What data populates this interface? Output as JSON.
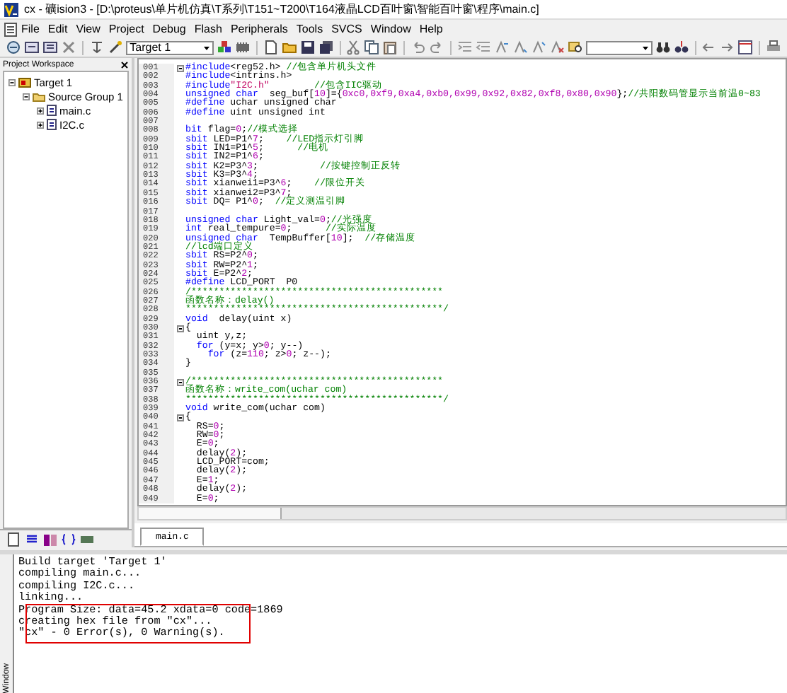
{
  "window": {
    "title": "cx - 礦ision3 - [D:\\proteus\\单片机仿真\\T系列\\T151~T200\\T164液晶LCD百叶窗\\智能百叶窗\\程序\\main.c]"
  },
  "menu": [
    "File",
    "Edit",
    "View",
    "Project",
    "Debug",
    "Flash",
    "Peripherals",
    "Tools",
    "SVCS",
    "Window",
    "Help"
  ],
  "toolbar": {
    "target": "Target 1"
  },
  "workspace": {
    "title": "Project Workspace",
    "tree": [
      {
        "label": "Target 1",
        "kind": "target",
        "expanded": true,
        "children": [
          {
            "label": "Source Group 1",
            "kind": "group",
            "expanded": true,
            "children": [
              {
                "label": "main.c",
                "kind": "file",
                "expanded": false
              },
              {
                "label": "I2C.c",
                "kind": "file",
                "expanded": false
              }
            ]
          }
        ]
      }
    ]
  },
  "editor": {
    "tabs": [
      {
        "label": "main.c",
        "selected": true
      }
    ],
    "lines": [
      {
        "number": "001",
        "fold": true,
        "parts": [
          {
            "kind": "keyword",
            "text": "#include"
          },
          {
            "kind": "plain",
            "text": "<reg52.h> "
          },
          {
            "kind": "comment",
            "text": "//包含单片机头文件"
          }
        ]
      },
      {
        "number": "002",
        "fold": false,
        "parts": [
          {
            "kind": "keyword",
            "text": "#include"
          },
          {
            "kind": "plain",
            "text": "<intrins.h>"
          }
        ]
      },
      {
        "number": "003",
        "fold": false,
        "parts": [
          {
            "kind": "keyword",
            "text": "#include"
          },
          {
            "kind": "string",
            "text": "\"I2C.h\""
          },
          {
            "kind": "comment",
            "text": "        //包含IIC驱动"
          }
        ]
      },
      {
        "number": "004",
        "fold": false,
        "parts": [
          {
            "kind": "keyword",
            "text": "unsigned char"
          },
          {
            "kind": "plain",
            "text": "  seg_buf["
          },
          {
            "kind": "number",
            "text": "10"
          },
          {
            "kind": "plain",
            "text": "]={"
          },
          {
            "kind": "number",
            "text": "0xc0,0xf9,0xa4,0xb0,0x99,0x92,0x82,0xf8,0x80,0x90"
          },
          {
            "kind": "plain",
            "text": "};"
          },
          {
            "kind": "comment",
            "text": "//共阳数码管显示当前温0~83"
          }
        ]
      },
      {
        "number": "005",
        "fold": false,
        "parts": [
          {
            "kind": "keyword",
            "text": "#define"
          },
          {
            "kind": "plain",
            "text": " uchar unsigned char"
          }
        ]
      },
      {
        "number": "006",
        "fold": false,
        "parts": [
          {
            "kind": "keyword",
            "text": "#define"
          },
          {
            "kind": "plain",
            "text": " uint unsigned int"
          }
        ]
      },
      {
        "number": "007",
        "fold": false
      },
      {
        "number": "008",
        "fold": false,
        "parts": [
          {
            "kind": "keyword",
            "text": "bit"
          },
          {
            "kind": "plain",
            "text": " flag="
          },
          {
            "kind": "number",
            "text": "0"
          },
          {
            "kind": "plain",
            "text": ";"
          },
          {
            "kind": "comment",
            "text": "//模式选择"
          }
        ]
      },
      {
        "number": "009",
        "fold": false,
        "parts": [
          {
            "kind": "keyword",
            "text": "sbit"
          },
          {
            "kind": "plain",
            "text": " LED=P1^"
          },
          {
            "kind": "number",
            "text": "7"
          },
          {
            "kind": "plain",
            "text": ";    "
          },
          {
            "kind": "comment",
            "text": "//LED指示灯引脚"
          }
        ]
      },
      {
        "number": "010",
        "fold": false,
        "parts": [
          {
            "kind": "keyword",
            "text": "sbit"
          },
          {
            "kind": "plain",
            "text": " IN1=P1^"
          },
          {
            "kind": "number",
            "text": "5"
          },
          {
            "kind": "plain",
            "text": ";      "
          },
          {
            "kind": "comment",
            "text": "//电机"
          }
        ]
      },
      {
        "number": "011",
        "fold": false,
        "parts": [
          {
            "kind": "keyword",
            "text": "sbit"
          },
          {
            "kind": "plain",
            "text": " IN2=P1^"
          },
          {
            "kind": "number",
            "text": "6"
          },
          {
            "kind": "plain",
            "text": ";"
          }
        ]
      },
      {
        "number": "012",
        "fold": false,
        "parts": [
          {
            "kind": "keyword",
            "text": "sbit"
          },
          {
            "kind": "plain",
            "text": " K2=P3^"
          },
          {
            "kind": "number",
            "text": "3"
          },
          {
            "kind": "plain",
            "text": ";           "
          },
          {
            "kind": "comment",
            "text": "//按键控制正反转"
          }
        ]
      },
      {
        "number": "013",
        "fold": false,
        "parts": [
          {
            "kind": "keyword",
            "text": "sbit"
          },
          {
            "kind": "plain",
            "text": " K3=P3^"
          },
          {
            "kind": "number",
            "text": "4"
          },
          {
            "kind": "plain",
            "text": ";"
          }
        ]
      },
      {
        "number": "014",
        "fold": false,
        "parts": [
          {
            "kind": "keyword",
            "text": "sbit"
          },
          {
            "kind": "plain",
            "text": " xianwei1=P3^"
          },
          {
            "kind": "number",
            "text": "6"
          },
          {
            "kind": "plain",
            "text": ";    "
          },
          {
            "kind": "comment",
            "text": "//限位开关"
          }
        ]
      },
      {
        "number": "015",
        "fold": false,
        "parts": [
          {
            "kind": "keyword",
            "text": "sbit"
          },
          {
            "kind": "plain",
            "text": " xianwei2=P3^"
          },
          {
            "kind": "number",
            "text": "7"
          },
          {
            "kind": "plain",
            "text": ";"
          }
        ]
      },
      {
        "number": "016",
        "fold": false,
        "parts": [
          {
            "kind": "keyword",
            "text": "sbit"
          },
          {
            "kind": "plain",
            "text": " DQ= P1^"
          },
          {
            "kind": "number",
            "text": "0"
          },
          {
            "kind": "plain",
            "text": ";  "
          },
          {
            "kind": "comment",
            "text": "//定义测温引脚"
          }
        ]
      },
      {
        "number": "017",
        "fold": false
      },
      {
        "number": "018",
        "fold": false,
        "parts": [
          {
            "kind": "keyword",
            "text": "unsigned char"
          },
          {
            "kind": "plain",
            "text": " Light_val="
          },
          {
            "kind": "number",
            "text": "0"
          },
          {
            "kind": "plain",
            "text": ";"
          },
          {
            "kind": "comment",
            "text": "//光强度"
          }
        ]
      },
      {
        "number": "019",
        "fold": false,
        "parts": [
          {
            "kind": "keyword",
            "text": "int"
          },
          {
            "kind": "plain",
            "text": " real_tempure="
          },
          {
            "kind": "number",
            "text": "0"
          },
          {
            "kind": "plain",
            "text": ";      "
          },
          {
            "kind": "comment",
            "text": "//实际温度"
          }
        ]
      },
      {
        "number": "020",
        "fold": false,
        "parts": [
          {
            "kind": "keyword",
            "text": "unsigned char"
          },
          {
            "kind": "plain",
            "text": "  TempBuffer["
          },
          {
            "kind": "number",
            "text": "10"
          },
          {
            "kind": "plain",
            "text": "];  "
          },
          {
            "kind": "comment",
            "text": "//存储温度"
          }
        ]
      },
      {
        "number": "021",
        "fold": false,
        "parts": [
          {
            "kind": "comment",
            "text": "//lcd端口定义"
          }
        ]
      },
      {
        "number": "022",
        "fold": false,
        "parts": [
          {
            "kind": "keyword",
            "text": "sbit"
          },
          {
            "kind": "plain",
            "text": " RS=P2^"
          },
          {
            "kind": "number",
            "text": "0"
          },
          {
            "kind": "plain",
            "text": ";"
          }
        ]
      },
      {
        "number": "023",
        "fold": false,
        "parts": [
          {
            "kind": "keyword",
            "text": "sbit"
          },
          {
            "kind": "plain",
            "text": " RW=P2^"
          },
          {
            "kind": "number",
            "text": "1"
          },
          {
            "kind": "plain",
            "text": ";"
          }
        ]
      },
      {
        "number": "024",
        "fold": false,
        "parts": [
          {
            "kind": "keyword",
            "text": "sbit"
          },
          {
            "kind": "plain",
            "text": " E=P2^"
          },
          {
            "kind": "number",
            "text": "2"
          },
          {
            "kind": "plain",
            "text": ";"
          }
        ]
      },
      {
        "number": "025",
        "fold": false,
        "parts": [
          {
            "kind": "keyword",
            "text": "#define"
          },
          {
            "kind": "plain",
            "text": " LCD_PORT  P0"
          }
        ]
      },
      {
        "number": "026",
        "fold": false,
        "parts": [
          {
            "kind": "comment",
            "text": "/*********************************************"
          }
        ]
      },
      {
        "number": "027",
        "fold": false,
        "parts": [
          {
            "kind": "comment",
            "text": "函数名称：delay()"
          }
        ]
      },
      {
        "number": "028",
        "fold": false,
        "parts": [
          {
            "kind": "comment",
            "text": "**********************************************/"
          }
        ]
      },
      {
        "number": "029",
        "fold": false,
        "parts": [
          {
            "kind": "keyword",
            "text": "void"
          },
          {
            "kind": "plain",
            "text": "  delay(uint x)"
          }
        ]
      },
      {
        "number": "030",
        "fold": true,
        "parts": [
          {
            "kind": "plain",
            "text": "{"
          }
        ]
      },
      {
        "number": "031",
        "fold": false,
        "parts": [
          {
            "kind": "plain",
            "text": "  uint y,z;"
          }
        ]
      },
      {
        "number": "032",
        "fold": false,
        "parts": [
          {
            "kind": "keyword",
            "text": "  for"
          },
          {
            "kind": "plain",
            "text": " (y=x; y>"
          },
          {
            "kind": "number",
            "text": "0"
          },
          {
            "kind": "plain",
            "text": "; y--)"
          }
        ]
      },
      {
        "number": "033",
        "fold": false,
        "parts": [
          {
            "kind": "keyword",
            "text": "    for"
          },
          {
            "kind": "plain",
            "text": " (z="
          },
          {
            "kind": "number",
            "text": "110"
          },
          {
            "kind": "plain",
            "text": "; z>"
          },
          {
            "kind": "number",
            "text": "0"
          },
          {
            "kind": "plain",
            "text": "; z--);"
          }
        ]
      },
      {
        "number": "034",
        "fold": false,
        "parts": [
          {
            "kind": "plain",
            "text": "}"
          }
        ]
      },
      {
        "number": "035",
        "fold": false
      },
      {
        "number": "036",
        "fold": true,
        "parts": [
          {
            "kind": "comment",
            "text": "/*********************************************"
          }
        ]
      },
      {
        "number": "037",
        "fold": false,
        "parts": [
          {
            "kind": "comment",
            "text": "函数名称：write_com(uchar com)"
          }
        ]
      },
      {
        "number": "038",
        "fold": false,
        "parts": [
          {
            "kind": "comment",
            "text": "**********************************************/"
          }
        ]
      },
      {
        "number": "039",
        "fold": false,
        "parts": [
          {
            "kind": "keyword",
            "text": "void"
          },
          {
            "kind": "plain",
            "text": " write_com(uchar com)"
          }
        ]
      },
      {
        "number": "040",
        "fold": true,
        "parts": [
          {
            "kind": "plain",
            "text": "{"
          }
        ]
      },
      {
        "number": "041",
        "fold": false,
        "parts": [
          {
            "kind": "plain",
            "text": "  RS="
          },
          {
            "kind": "number",
            "text": "0"
          },
          {
            "kind": "plain",
            "text": ";"
          }
        ]
      },
      {
        "number": "042",
        "fold": false,
        "parts": [
          {
            "kind": "plain",
            "text": "  RW="
          },
          {
            "kind": "number",
            "text": "0"
          },
          {
            "kind": "plain",
            "text": ";"
          }
        ]
      },
      {
        "number": "043",
        "fold": false,
        "parts": [
          {
            "kind": "plain",
            "text": "  E="
          },
          {
            "kind": "number",
            "text": "0"
          },
          {
            "kind": "plain",
            "text": ";"
          }
        ]
      },
      {
        "number": "044",
        "fold": false,
        "parts": [
          {
            "kind": "plain",
            "text": "  delay("
          },
          {
            "kind": "number",
            "text": "2"
          },
          {
            "kind": "plain",
            "text": ");"
          }
        ]
      },
      {
        "number": "045",
        "fold": false,
        "parts": [
          {
            "kind": "plain",
            "text": "  LCD_PORT=com;"
          }
        ]
      },
      {
        "number": "046",
        "fold": false,
        "parts": [
          {
            "kind": "plain",
            "text": "  delay("
          },
          {
            "kind": "number",
            "text": "2"
          },
          {
            "kind": "plain",
            "text": ");"
          }
        ]
      },
      {
        "number": "047",
        "fold": false,
        "parts": [
          {
            "kind": "plain",
            "text": "  E="
          },
          {
            "kind": "number",
            "text": "1"
          },
          {
            "kind": "plain",
            "text": ";"
          }
        ]
      },
      {
        "number": "048",
        "fold": false,
        "parts": [
          {
            "kind": "plain",
            "text": "  delay("
          },
          {
            "kind": "number",
            "text": "2"
          },
          {
            "kind": "plain",
            "text": ");"
          }
        ]
      },
      {
        "number": "049",
        "fold": false,
        "parts": [
          {
            "kind": "plain",
            "text": "  E="
          },
          {
            "kind": "number",
            "text": "0"
          },
          {
            "kind": "plain",
            "text": ";"
          }
        ]
      }
    ]
  },
  "output": {
    "title": "Window",
    "lines": [
      {
        "text": "Build target 'Target 1'",
        "highlighted": false
      },
      {
        "text": "compiling main.c...",
        "highlighted": false
      },
      {
        "text": "compiling I2C.c...",
        "highlighted": false
      },
      {
        "text": "linking...",
        "highlighted": false
      },
      {
        "text": "Program Size: data=45.2 xdata=0 code=1869",
        "highlighted": true
      },
      {
        "text": "creating hex file from \"cx\"...",
        "highlighted": true
      },
      {
        "text": "\"cx\" - 0 Error(s), 0 Warning(s).",
        "highlighted": true
      }
    ]
  }
}
